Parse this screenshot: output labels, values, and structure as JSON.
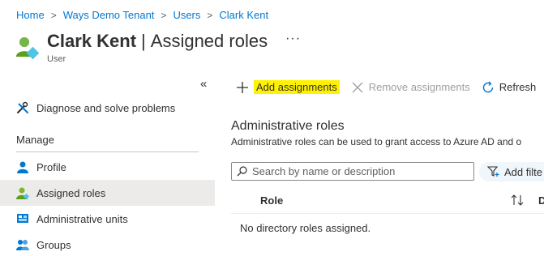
{
  "breadcrumb": {
    "items": [
      "Home",
      "Ways Demo Tenant",
      "Users",
      "Clark Kent"
    ],
    "separator": ">"
  },
  "header": {
    "name": "Clark Kent",
    "divider": "|",
    "page": "Assigned roles",
    "more": "···",
    "subtitle": "User",
    "icon": "user-icon"
  },
  "sidebar": {
    "collapse": "«",
    "diagnose_label": "Diagnose and solve problems",
    "section_label": "Manage",
    "items": [
      {
        "label": "Profile",
        "icon": "profile-icon"
      },
      {
        "label": "Assigned roles",
        "icon": "assigned-roles-icon",
        "active": true
      },
      {
        "label": "Administrative units",
        "icon": "admin-units-icon"
      },
      {
        "label": "Groups",
        "icon": "groups-icon"
      }
    ]
  },
  "toolbar": {
    "add_label": "Add assignments",
    "remove_label": "Remove assignments",
    "refresh_label": "Refresh"
  },
  "content": {
    "title": "Administrative roles",
    "description": "Administrative roles can be used to grant access to Azure AD and o"
  },
  "search": {
    "placeholder": "Search by name or description",
    "value": ""
  },
  "filter": {
    "label": "Add filte"
  },
  "table": {
    "columns": [
      "Role",
      "D"
    ],
    "empty_message": "No directory roles assigned."
  },
  "colors": {
    "link": "#0078d4",
    "highlight": "#fff200",
    "active_nav": "#edebe9",
    "filter_bg": "#eff6fc"
  }
}
